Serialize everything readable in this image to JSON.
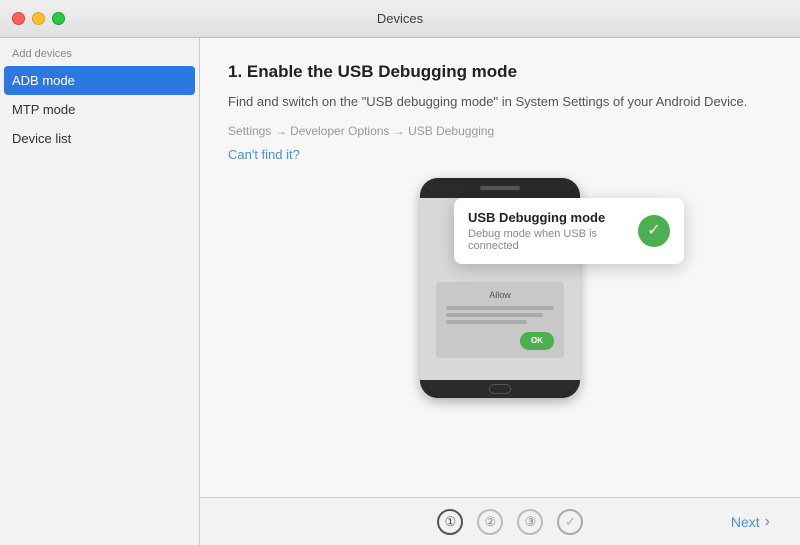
{
  "window": {
    "title": "Devices"
  },
  "sidebar": {
    "section_label": "Add devices",
    "items": [
      {
        "id": "adb-mode",
        "label": "ADB mode",
        "active": true
      },
      {
        "id": "mtp-mode",
        "label": "MTP mode",
        "active": false
      },
      {
        "id": "device-list",
        "label": "Device list",
        "active": false
      }
    ]
  },
  "content": {
    "step_title": "1. Enable the USB Debugging mode",
    "step_desc": "Find and switch on the \"USB debugging mode\" in System Settings of your Android Device.",
    "step_path": "Settings → Developer Options → USB Debugging",
    "cant_find_label": "Can't find it?",
    "popup": {
      "title": "USB Debugging mode",
      "subtitle": "Debug mode when USB is connected"
    },
    "phone": {
      "allow_text": "Allow",
      "ok_text": "OK"
    }
  },
  "bottom": {
    "next_label": "Next",
    "step_indicators": [
      {
        "label": "①",
        "type": "circled-one"
      },
      {
        "label": "②",
        "type": "circled-two"
      },
      {
        "label": "③",
        "type": "circled-three"
      },
      {
        "label": "✓",
        "type": "check"
      }
    ]
  }
}
